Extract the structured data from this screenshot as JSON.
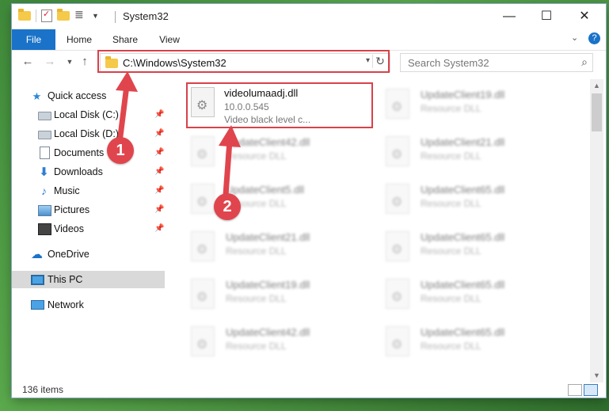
{
  "window": {
    "title": "System32"
  },
  "ribbon": {
    "tabs": [
      "File",
      "Home",
      "Share",
      "View"
    ]
  },
  "address": {
    "path": "C:\\Windows\\System32"
  },
  "search": {
    "placeholder": "Search System32"
  },
  "nav": {
    "items": [
      {
        "label": "Quick access",
        "icon": "star-icon",
        "pinned": false
      },
      {
        "label": "Local Disk (C:)",
        "icon": "drive-icon",
        "pinned": true
      },
      {
        "label": "Local Disk (D:)",
        "icon": "drive-icon",
        "pinned": true
      },
      {
        "label": "Documents",
        "icon": "documents-icon",
        "pinned": true
      },
      {
        "label": "Downloads",
        "icon": "downloads-icon",
        "pinned": true
      },
      {
        "label": "Music",
        "icon": "music-icon",
        "pinned": true
      },
      {
        "label": "Pictures",
        "icon": "pictures-icon",
        "pinned": true
      },
      {
        "label": "Videos",
        "icon": "videos-icon",
        "pinned": true
      },
      {
        "label": "OneDrive",
        "icon": "onedrive-icon",
        "pinned": false
      },
      {
        "label": "This PC",
        "icon": "this-pc-icon",
        "pinned": false,
        "selected": true
      },
      {
        "label": "Network",
        "icon": "network-icon",
        "pinned": false
      }
    ]
  },
  "files": {
    "focused": {
      "name": "videolumaadj.dll",
      "version": "10.0.0.545",
      "description": "Video black level c..."
    },
    "column1": [
      {
        "name": "UpdateClient42.dll",
        "type": "Resource DLL"
      },
      {
        "name": "UpdateClient5.dll",
        "type": "Resource DLL"
      },
      {
        "name": "UpdateClient21.dll",
        "type": "Resource DLL"
      },
      {
        "name": "UpdateClient19.dll",
        "type": "Resource DLL"
      },
      {
        "name": "UpdateClient42.dll",
        "type": "Resource DLL"
      }
    ],
    "column2": [
      {
        "name": "UpdateClient19.dll",
        "type": "Resource DLL"
      },
      {
        "name": "UpdateClient21.dll",
        "type": "Resource DLL"
      },
      {
        "name": "UpdateClient65.dll",
        "type": "Resource DLL"
      },
      {
        "name": "UpdateClient65.dll",
        "type": "Resource DLL"
      },
      {
        "name": "UpdateClient65.dll",
        "type": "Resource DLL"
      },
      {
        "name": "UpdateClient65.dll",
        "type": "Resource DLL"
      }
    ]
  },
  "status": {
    "count": "136 items"
  },
  "callouts": {
    "first": "1",
    "second": "2"
  },
  "colors": {
    "accent": "#1a73c8",
    "highlight": "#d9414a",
    "selected": "#d9d9d9"
  }
}
